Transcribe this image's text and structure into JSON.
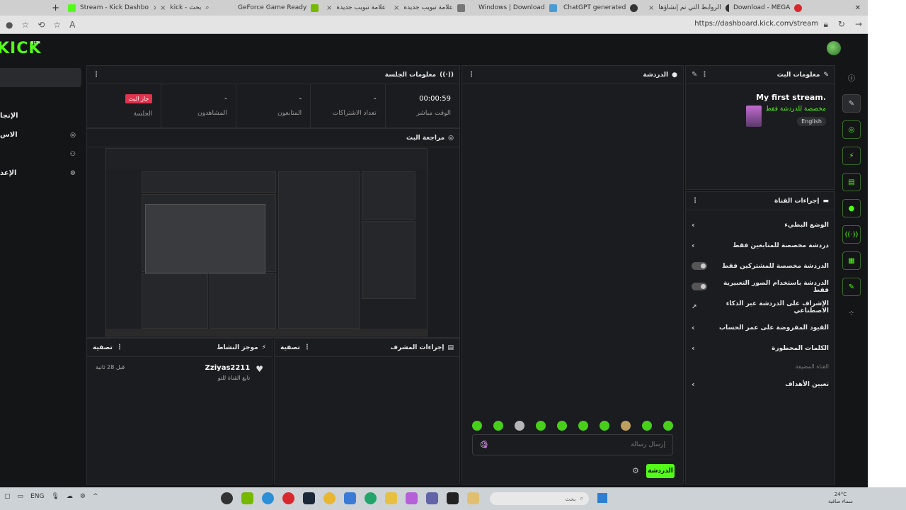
{
  "browser": {
    "tabs": [
      {
        "label": "Stream - Kick Dashbo"
      },
      {
        "label": "kick - بحث"
      },
      {
        "label": "GeForce Game Ready"
      },
      {
        "label": "علامة تبويب جديدة"
      },
      {
        "label": "علامة تبويب جديدة"
      },
      {
        "label": "Windows | Download"
      },
      {
        "label": "ChatGPT generated"
      },
      {
        "label": "الروابط التي تم إنشاؤها"
      },
      {
        "label": "Download - MEGA"
      }
    ],
    "url": "https://dashboard.kick.com/stream"
  },
  "header": {
    "logo": "KICK",
    "beta": "BETA"
  },
  "sidenav": {
    "items": [
      {
        "label": "",
        "icon": ""
      },
      {
        "label": "",
        "icon": ""
      },
      {
        "label": "الإنجا",
        "icon": ""
      },
      {
        "label": "الاس",
        "icon": "target-icon"
      },
      {
        "label": "",
        "icon": "users-icon"
      },
      {
        "label": "الإعد",
        "icon": "gear-icon"
      }
    ]
  },
  "session": {
    "title": "معلومات الجلسة",
    "stats": [
      {
        "value": "00:00:59",
        "label": "الوقت مباشر"
      },
      {
        "value": "-",
        "label": "تعداد الاشتراكات"
      },
      {
        "value": "-",
        "label": "المتابعون"
      },
      {
        "value": "-",
        "label": "المشاهدون"
      },
      {
        "value": "جاز البث",
        "label": "الجلسة"
      }
    ]
  },
  "preview": {
    "title": "مراجعة البث"
  },
  "chat": {
    "title": "الدردشة",
    "placeholder": "إرسال رسالة",
    "send_label": "الدردشة"
  },
  "stream_info": {
    "title": "معلومات البث",
    "stream_title": "My first stream.",
    "category": "مخصصة للدردشة فقط",
    "language": "English"
  },
  "channel_actions": {
    "title": "إجراءات القناة",
    "items": [
      {
        "label": "الوضع البطيء",
        "control": "arrow"
      },
      {
        "label": "دردشة مخصصة للمتابعين فقط",
        "control": "arrow"
      },
      {
        "label": "الدردشة مخصصة للمشتركين فقط",
        "control": "toggle"
      },
      {
        "label": "الدردشة باستخدام الصور التعبيرية فقط",
        "control": "toggle"
      },
      {
        "label": "الإشراف على الدردشة عبر الذكاء الاصطناعي",
        "control": "external"
      },
      {
        "label": "القيود المفروضة على عمر الحساب",
        "control": "arrow"
      },
      {
        "label": "الكلمات المحظورة",
        "control": "arrow"
      }
    ],
    "section_label": "القناة المضيفة",
    "goals_label": "تعيين الأهداف"
  },
  "activity": {
    "title": "موجز النشاط",
    "filter": "تصفية",
    "items": [
      {
        "user": "Zziyas2211",
        "action": "تابع القناة للتو",
        "time": "قبل 28 ثانية"
      }
    ]
  },
  "mod_actions": {
    "title": "إجراءات المشرف",
    "filter": "تصفية"
  },
  "taskbar": {
    "lang": "ENG",
    "search": "بحث",
    "temp": "24°C",
    "weather": "سماء صافية"
  }
}
